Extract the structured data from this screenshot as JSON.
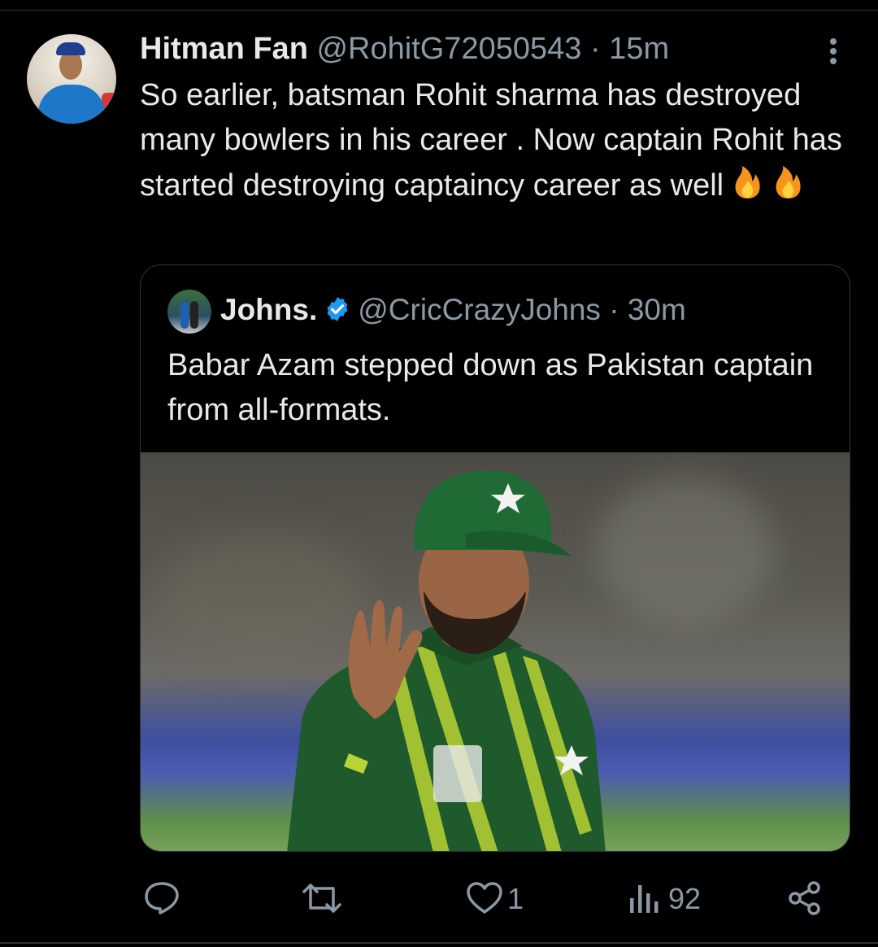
{
  "tweet": {
    "author_name": "Hitman Fan",
    "handle": "@RohitG72050543",
    "separator": "·",
    "time": "15m",
    "text": "So earlier,  batsman Rohit sharma has destroyed many bowlers in his career . Now captain Rohit has started destroying captaincy career as well",
    "emoji": "🔥 🔥"
  },
  "quoted_tweet": {
    "author_name": "Johns.",
    "handle": "@CricCrazyJohns",
    "separator": "·",
    "time": "30m",
    "text": "Babar Azam stepped down as Pakistan captain from all-formats.",
    "verified": true
  },
  "actions": {
    "reply_count": "",
    "retweet_count": "",
    "like_count": "1",
    "view_count": "92"
  },
  "colors": {
    "background": "#000000",
    "text_primary": "#e7e9ea",
    "text_secondary": "#8b98a5",
    "border": "#2f3336",
    "verified_badge": "#1d9bf0"
  },
  "icons": [
    "more-options-icon",
    "verified-badge-icon",
    "reply-icon",
    "retweet-icon",
    "like-icon",
    "views-icon",
    "share-icon",
    "fire-emoji"
  ]
}
